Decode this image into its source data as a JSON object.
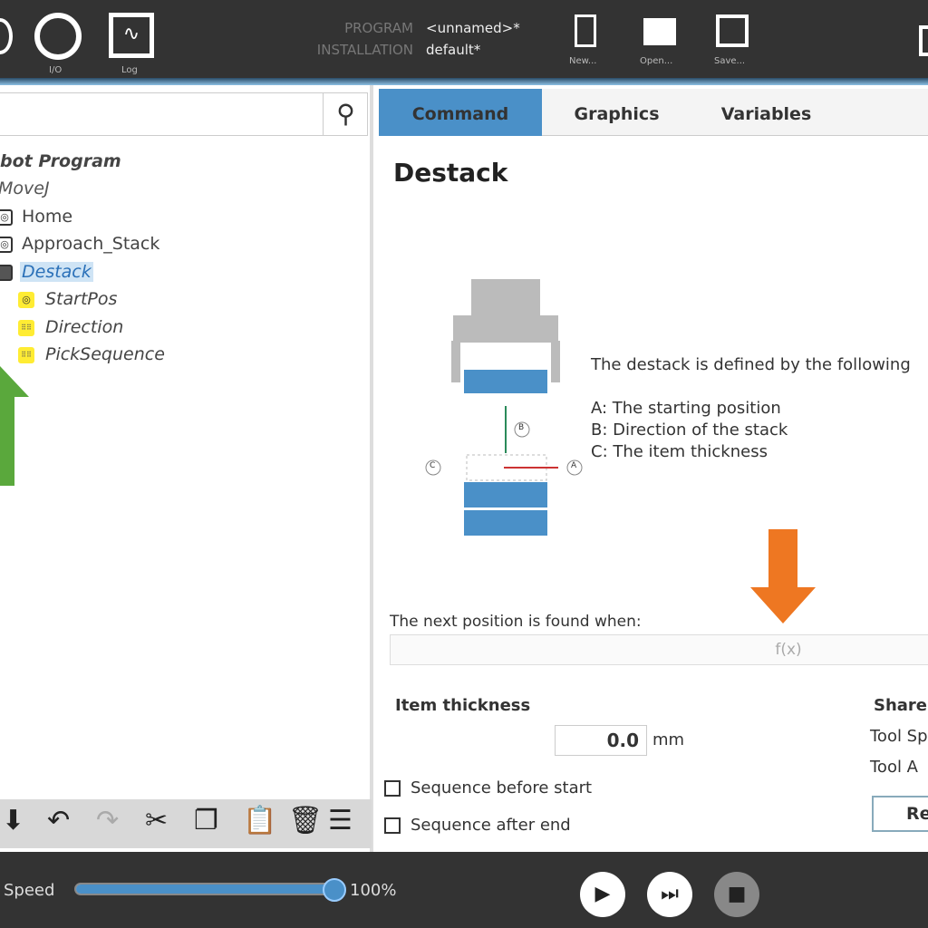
{
  "header": {
    "io_label": "I/O",
    "log_label": "Log",
    "program_key": "PROGRAM",
    "program_value": "<unnamed>*",
    "installation_key": "INSTALLATION",
    "installation_value": "default*",
    "new_label": "New...",
    "open_label": "Open...",
    "save_label": "Save..."
  },
  "tree": {
    "root": "bot Program",
    "items": [
      {
        "label": "MoveJ",
        "icon": "none"
      },
      {
        "label": "Home",
        "icon": "waypoint-icon"
      },
      {
        "label": "Approach_Stack",
        "icon": "waypoint-icon"
      },
      {
        "label": "Destack",
        "icon": "destack-icon",
        "selected": true
      },
      {
        "label": "StartPos",
        "icon": "waypoint-icon"
      },
      {
        "label": "Direction",
        "icon": "grid-icon"
      },
      {
        "label": "PickSequence",
        "icon": "grid-icon"
      }
    ]
  },
  "tabs": [
    {
      "label": "Command",
      "active": true
    },
    {
      "label": "Graphics"
    },
    {
      "label": "Variables"
    }
  ],
  "main": {
    "title": "Destack",
    "desc": "The destack is defined by the following",
    "a": "A: The starting position",
    "b": "B: Direction of the stack",
    "c": "C: The item thickness",
    "diagram": {
      "la": "A",
      "lb": "B",
      "lc": "C"
    },
    "next_label": "The next position is found when:",
    "fx": "f(x)",
    "thickness_label": "Item thickness",
    "thickness_value": "0.0",
    "thickness_unit": "mm",
    "seq_before": "Sequence before start",
    "seq_after": "Sequence after end",
    "shared_label": "Share",
    "tool_speed": "Tool Sp",
    "tool_acc": "Tool A",
    "reset_button": "Re"
  },
  "footer": {
    "speed_label": "Speed",
    "speed_percent": "100%",
    "speed_value": 100
  },
  "colors": {
    "accent": "#4a90c8",
    "arrow_green": "#5aa83c",
    "arrow_orange": "#ee7722",
    "tree_yellow": "#ffec33"
  }
}
